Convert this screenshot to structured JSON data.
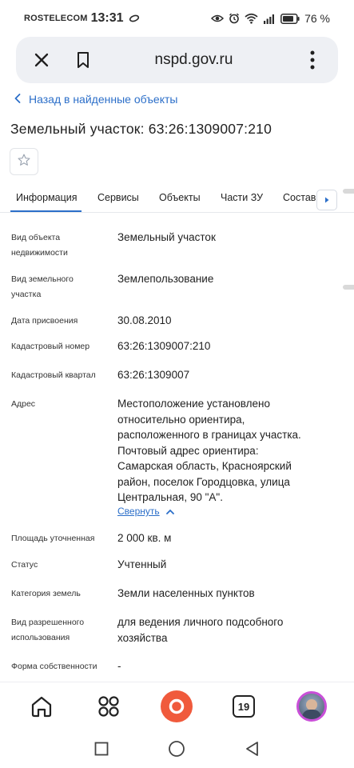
{
  "status_bar": {
    "carrier": "ROSTELECOM",
    "time": "13:31",
    "battery": "76 %"
  },
  "browser": {
    "url": "nspd.gov.ru",
    "tabs_count": "19"
  },
  "page": {
    "back_link": "Назад в найденные объекты",
    "title": "Земельный участок: 63:26:1309007:210",
    "tabs": [
      "Информация",
      "Сервисы",
      "Объекты",
      "Части ЗУ",
      "Состав"
    ],
    "active_tab": "Информация",
    "collapse_link": "Свернуть"
  },
  "properties": [
    {
      "label_lines": [
        "Вид объекта",
        "недвижимости"
      ],
      "value_lines": [
        "Земельный участок"
      ]
    },
    {
      "label_lines": [
        "Вид земельного",
        "участка"
      ],
      "value_lines": [
        "Землепользование"
      ]
    },
    {
      "label_lines": [
        "Дата присвоения"
      ],
      "value_lines": [
        "30.08.2010"
      ]
    },
    {
      "label_lines": [
        "Кадастровый номер"
      ],
      "value_lines": [
        "63:26:1309007:210"
      ]
    },
    {
      "label_lines": [
        "Кадастровый квартал"
      ],
      "value_lines": [
        "63:26:1309007"
      ]
    },
    {
      "label_lines": [
        "Адрес"
      ],
      "value_lines": [
        "Местоположение установлено",
        "относительно ориентира,",
        "расположенного в границах участка.",
        "Почтовый адрес ориентира:",
        "Самарская область, Красноярский",
        "район, поселок Городцовка, улица",
        "Центральная, 90 \"А\"."
      ]
    },
    {
      "label_lines": [
        "Площадь уточненная"
      ],
      "value_lines": [
        "2 000 кв. м"
      ]
    },
    {
      "label_lines": [
        "Статус"
      ],
      "value_lines": [
        "Учтенный"
      ]
    },
    {
      "label_lines": [
        "Категория земель"
      ],
      "value_lines": [
        "Земли населенных пунктов"
      ]
    },
    {
      "label_lines": [
        "Вид разрешенного",
        "использования"
      ],
      "value_lines": [
        "для ведения личного подсобного",
        "хозяйства"
      ]
    },
    {
      "label_lines": [
        "Форма собственности"
      ],
      "value_lines": [
        "-"
      ]
    }
  ],
  "icons": {
    "back": "chevron-left-icon",
    "favorite": "star-outline-icon",
    "close": "close-icon",
    "bookmark": "bookmark-icon",
    "menu": "more-vertical-icon",
    "home": "home-icon",
    "services": "grid-icon",
    "assistant": "alice-icon",
    "tabs": "tabs-icon"
  },
  "colors": {
    "accent": "#2c6fc9",
    "url_bar_bg": "#eef0f4",
    "assistant": "#f05a3c",
    "avatar_ring": "#c94fd8"
  }
}
